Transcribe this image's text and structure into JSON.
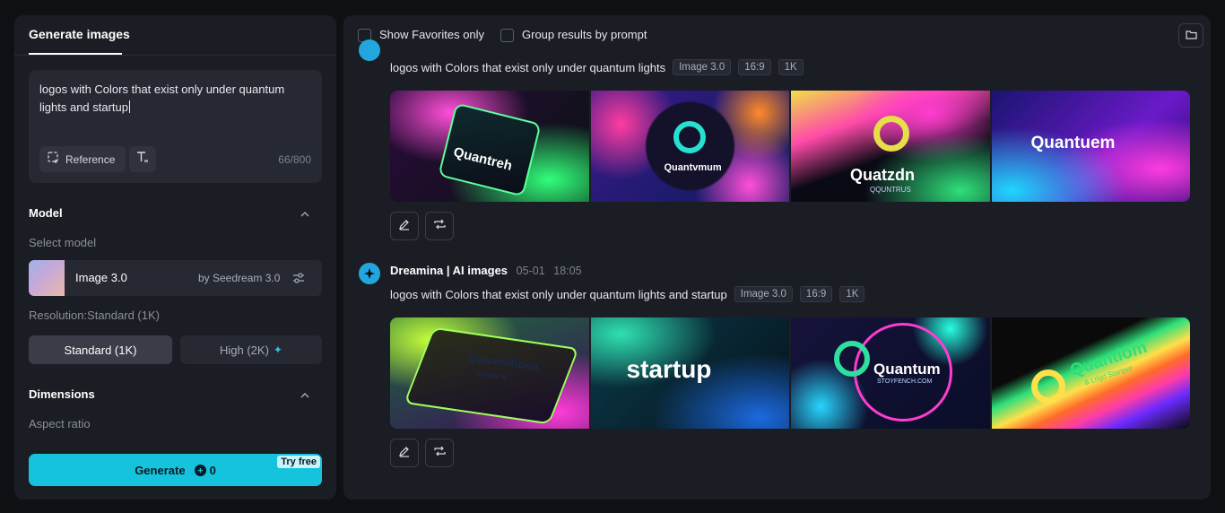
{
  "left": {
    "tab": "Generate images",
    "prompt": {
      "text": "logos with Colors that exist only under quantum lights and startup",
      "reference_label": "Reference",
      "char_count": "66/800"
    },
    "model": {
      "section_title": "Model",
      "select_label": "Select model",
      "name": "Image 3.0",
      "by": "by Seedream 3.0",
      "resolution_label": "Resolution:Standard (1K)",
      "standard_label": "Standard (1K)",
      "high_label": "High (2K)"
    },
    "dimensions": {
      "section_title": "Dimensions",
      "aspect_label": "Aspect ratio"
    },
    "generate": {
      "label": "Generate",
      "cost": "0",
      "badge": "Try free"
    }
  },
  "right": {
    "filters": {
      "favorites": "Show Favorites only",
      "group": "Group results by prompt"
    },
    "results": [
      {
        "prompt": "logos with Colors that exist only under quantum lights",
        "tags": [
          "Image 3.0",
          "16:9",
          "1K"
        ],
        "images": [
          {
            "logo": "Quantreh"
          },
          {
            "logo": "Quantvmum"
          },
          {
            "logo": "Quatzdn",
            "sub": "QQUNTRUS"
          },
          {
            "logo": "Quantuem"
          }
        ]
      },
      {
        "author": "Dreamina | AI images",
        "date": "05-01",
        "time": "18:05",
        "prompt": "logos with Colors that exist only under quantum lights and startup",
        "tags": [
          "Image 3.0",
          "16:9",
          "1K"
        ],
        "images": [
          {
            "logo": "Quuamifiona",
            "sub": "Startor &"
          },
          {
            "logo": "startup"
          },
          {
            "logo": "Quantum",
            "sub": "STOYFENCH.COM"
          },
          {
            "logo": "Quantiom",
            "sub": "& Lrigd Startpor"
          }
        ]
      }
    ]
  },
  "colors": {
    "accent": "#16c3dd",
    "panel": "#1b1d24",
    "background": "#0f1014"
  },
  "icons": [
    "reference-icon",
    "text-format-icon",
    "chevron-up-icon",
    "settings-sliders-icon",
    "sparkle-icon",
    "coin-icon",
    "folder-icon",
    "edit-icon",
    "regenerate-icon",
    "dreamina-star-icon"
  ]
}
